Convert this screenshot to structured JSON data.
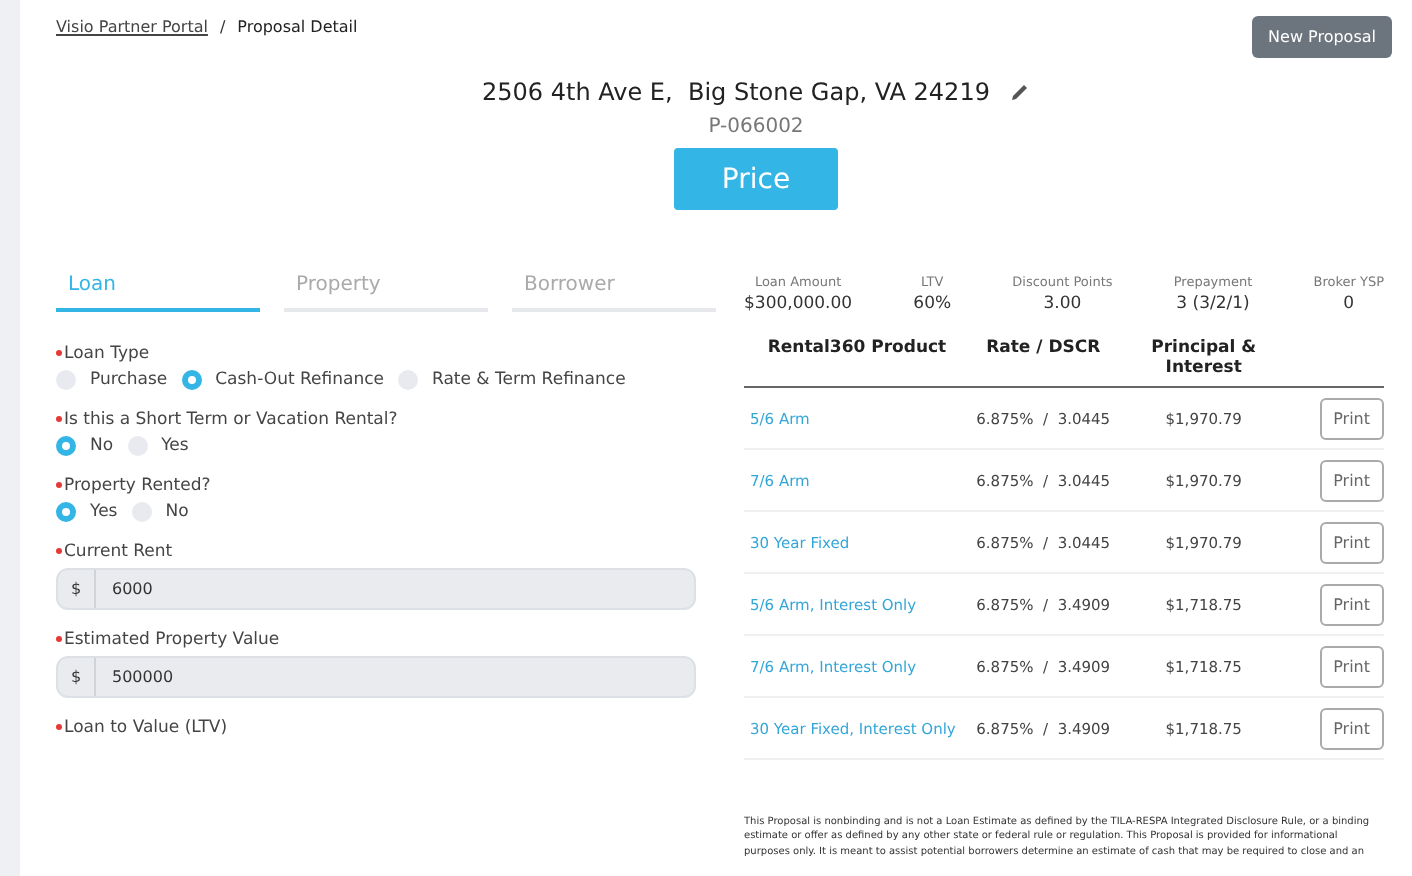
{
  "breadcrumb": {
    "link": "Visio Partner Portal",
    "separator": "/",
    "current": "Proposal Detail"
  },
  "new_button": "New Proposal",
  "address": "2506 4th Ave E,  Big Stone Gap, VA 24219",
  "proposal_id": "P-066002",
  "price_button": "Price",
  "tabs": [
    {
      "label": "Loan",
      "selected": true
    },
    {
      "label": "Property",
      "selected": false
    },
    {
      "label": "Borrower",
      "selected": false
    }
  ],
  "form": [
    {
      "kind": "radio",
      "label": "Loan Type",
      "required": true,
      "options": [
        {
          "label": "Purchase",
          "selected": false
        },
        {
          "label": "Cash-Out Refinance",
          "selected": true
        },
        {
          "label": "Rate & Term Refinance",
          "selected": false
        }
      ]
    },
    {
      "kind": "radio",
      "label": "Is this a Short Term or Vacation Rental?",
      "required": true,
      "options": [
        {
          "label": "No",
          "selected": true
        },
        {
          "label": "Yes",
          "selected": false
        }
      ]
    },
    {
      "kind": "radio",
      "label": "Property Rented?",
      "required": true,
      "options": [
        {
          "label": "Yes",
          "selected": true
        },
        {
          "label": "No",
          "selected": false
        }
      ]
    },
    {
      "kind": "money",
      "label": "Current Rent",
      "required": true,
      "prefix": "$",
      "value": "6000"
    },
    {
      "kind": "money",
      "label": "Estimated Property Value",
      "required": true,
      "prefix": "$",
      "value": "500000"
    },
    {
      "kind": "heading",
      "label": "Loan to Value (LTV)",
      "required": true
    }
  ],
  "summary": [
    {
      "label": "Loan Amount",
      "value": "$300,000.00"
    },
    {
      "label": "LTV",
      "value": "60%"
    },
    {
      "label": "Discount Points",
      "value": "3.00"
    },
    {
      "label": "Prepayment",
      "value": "3 (3/2/1)"
    },
    {
      "label": "Broker YSP",
      "value": "0"
    }
  ],
  "table": {
    "columns": [
      "Rental360 Product",
      "Rate / DSCR",
      "Principal & Interest"
    ],
    "rows": [
      {
        "product": "5/6 Arm",
        "rate": "6.875%  /  3.0445",
        "payment": "$1,970.79",
        "action": "Print"
      },
      {
        "product": "7/6 Arm",
        "rate": "6.875%  /  3.0445",
        "payment": "$1,970.79",
        "action": "Print"
      },
      {
        "product": "30 Year Fixed",
        "rate": "6.875%  /  3.0445",
        "payment": "$1,970.79",
        "action": "Print"
      },
      {
        "product": "5/6 Arm, Interest Only",
        "rate": "6.875%  /  3.4909",
        "payment": "$1,718.75",
        "action": "Print"
      },
      {
        "product": "7/6 Arm, Interest Only",
        "rate": "6.875%  /  3.4909",
        "payment": "$1,718.75",
        "action": "Print"
      },
      {
        "product": "30 Year Fixed, Interest Only",
        "rate": "6.875%  /  3.4909",
        "payment": "$1,718.75",
        "action": "Print"
      }
    ]
  },
  "disclaimer": "This Proposal is nonbinding and is not a Loan Estimate as defined by the TILA-RESPA Integrated Disclosure Rule, or a binding estimate or offer as defined by any other state or federal rule or regulation. This Proposal is provided for informational purposes only. It is meant to assist potential borrowers determine an estimate of cash that may be required to close and an"
}
